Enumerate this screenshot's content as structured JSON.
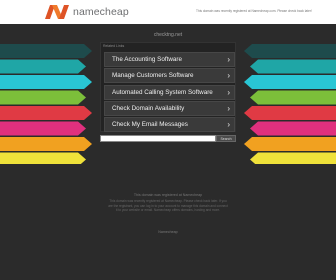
{
  "header": {
    "logo_text": "namecheap",
    "notice": "This domain was recently registered at Namecheap.com. Please check back later!",
    "notice_link": "Namecheap.com"
  },
  "domain": "checktng.net",
  "panel": {
    "label": "Related Links",
    "items": [
      {
        "label": "The Accounting Software"
      },
      {
        "label": "Manage Customers Software"
      },
      {
        "label": "Automated Calling System Software"
      },
      {
        "label": "Check Domain Availability"
      },
      {
        "label": "Check My Email Messages"
      }
    ]
  },
  "search": {
    "placeholder": "",
    "button": "Search"
  },
  "footer": {
    "heading": "This domain was registered at Namecheap",
    "body": "This domain was recently registered at Namecheap. Please check back later. If you are the registrant, you can log in to your account to manage this domain and connect it to your website or email. Namecheap offers domains, hosting and more.",
    "link": "Namecheap"
  },
  "colors": {
    "brand_orange": "#de5326",
    "left_bands": [
      "#1e4b4c",
      "#1fa6a6",
      "#29c6d4",
      "#7cbf3a",
      "#e03a44",
      "#e0307e",
      "#f1a120",
      "#efe13a"
    ],
    "right_bands": [
      "#1e4b4c",
      "#1fa6a6",
      "#29c6d4",
      "#7cbf3a",
      "#e03a44",
      "#e0307e",
      "#f1a120",
      "#efe13a"
    ]
  },
  "icons": {
    "logo": "namecheap-n-icon",
    "chevron": "chevron-right-icon"
  }
}
